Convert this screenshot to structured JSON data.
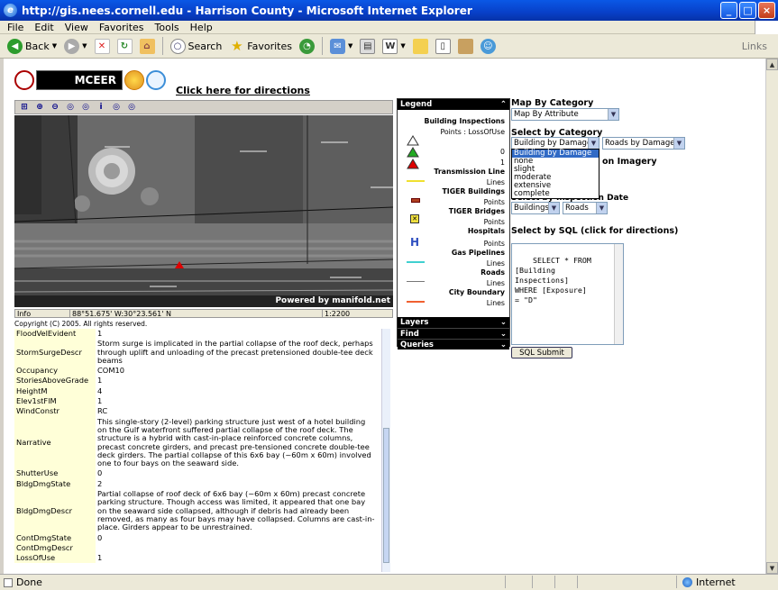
{
  "window": {
    "title": "http://gis.nees.cornell.edu - Harrison County - Microsoft Internet Explorer"
  },
  "menu": [
    "File",
    "Edit",
    "View",
    "Favorites",
    "Tools",
    "Help"
  ],
  "toolbar": {
    "back": "Back",
    "search": "Search",
    "favorites": "Favorites",
    "links": "Links"
  },
  "header": {
    "directions": "Click here for directions"
  },
  "map": {
    "powered": "Powered by manifold.net",
    "info": "Info",
    "coords": "88°51.675' W:30°23.561' N",
    "scale": "1:2200"
  },
  "copyright": "Copyright (C) 2005. All rights reserved.",
  "attributes": [
    {
      "k": "FloodVelEvident",
      "v": "1"
    },
    {
      "k": "StormSurgeDescr",
      "v": "Storm surge is implicated in the partial collapse of the roof deck, perhaps through uplift and unloading of the precast pretensioned double-tee deck beams"
    },
    {
      "k": "Occupancy",
      "v": "COM10"
    },
    {
      "k": "StoriesAboveGrade",
      "v": "1"
    },
    {
      "k": "HeightM",
      "v": "4"
    },
    {
      "k": "Elev1stFlM",
      "v": "1"
    },
    {
      "k": "WindConstr",
      "v": "RC"
    },
    {
      "k": "Narrative",
      "v": "This single-story (2-level) parking structure just west of a hotel building on the Gulf waterfront suffered partial collapse of the roof deck. The structure is a hybrid with cast-in-place reinforced concrete columns, precast concrete girders, and precast pre-tensioned concrete double-tee deck girders. The partial collapse of this 6x6 bay (~60m x 60m) involved one to four bays on the seaward side."
    },
    {
      "k": "ShutterUse",
      "v": "0"
    },
    {
      "k": "BldgDmgState",
      "v": "2"
    },
    {
      "k": "BldgDmgDescr",
      "v": "Partial collapse of roof deck of 6x6 bay (~60m x 60m) precast concrete parking structure. Though access was limited, it appeared that one bay on the seaward side collapsed, although if debris had already been removed, as many as four bays may have collapsed. Columns are cast-in-place. Girders appear to be unrestrained."
    },
    {
      "k": "ContDmgState",
      "v": "0"
    },
    {
      "k": "ContDmgDescr",
      "v": ""
    },
    {
      "k": "LossOfUse",
      "v": "1"
    }
  ],
  "legend": {
    "title": "Legend",
    "building_inspections": "Building Inspections",
    "points_loss": "Points : LossOfUse",
    "v0": "0",
    "v1": "1",
    "transmission": "Transmission Line",
    "lines1": "Lines",
    "tiger_buildings": "TIGER Buildings",
    "points1": "Points",
    "tiger_bridges": "TIGER Bridges",
    "points2": "Points",
    "hospitals": "Hospitals",
    "points3": "Points",
    "gas": "Gas Pipelines",
    "lines2": "Lines",
    "roads": "Roads",
    "lines3": "Lines",
    "city": "City Boundary",
    "lines4": "Lines",
    "layers": "Layers",
    "find": "Find",
    "queries": "Queries"
  },
  "panel": {
    "map_by_category": "Map By Category",
    "map_by_attr": "Map By Attribute",
    "select_by_category": "Select by Category",
    "bldg_dmg": "Building by Damage",
    "roads_dmg": "Roads by Damage",
    "imagery_partial": "on Imagery",
    "insp_date_partial": "Select by Inspection Date",
    "buildings": "Buildings",
    "roads_sel": "Roads",
    "sql_title": "Select by SQL (click for directions)",
    "sql_text": "SELECT * FROM\n[Building\nInspections]\nWHERE [Exposure]\n= \"D\"",
    "sql_submit": "SQL Submit"
  },
  "dropdown_options": [
    "Building by Damage",
    "none",
    "slight",
    "moderate",
    "extensive",
    "complete"
  ],
  "status": {
    "text": "Done",
    "zone": "Internet"
  }
}
